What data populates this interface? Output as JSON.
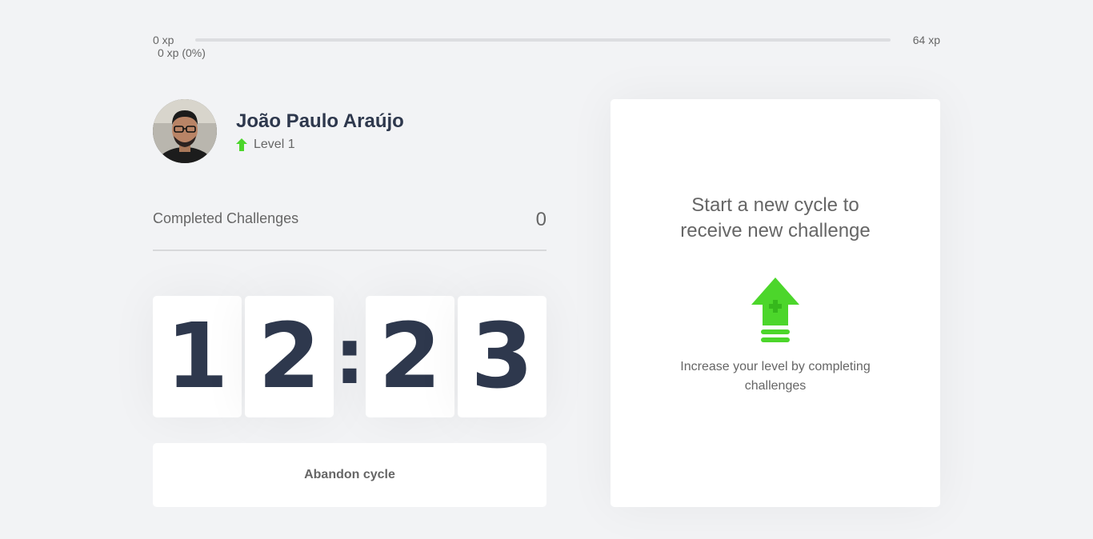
{
  "xp": {
    "min_label": "0 xp",
    "max_label": "64 xp",
    "current_label": "0 xp (0%)",
    "progress_percent": 0
  },
  "profile": {
    "name": "João Paulo Araújo",
    "level_label": "Level 1",
    "avatar_icon": "user-avatar-photo"
  },
  "completed": {
    "label": "Completed Challenges",
    "count": "0"
  },
  "countdown": {
    "minute_left": "1",
    "minute_right": "2",
    "separator": ":",
    "second_left": "2",
    "second_right": "3"
  },
  "abandon": {
    "label": "Abandon cycle"
  },
  "challenge": {
    "title": "Start a new cycle to receive new challenge",
    "hint": "Increase your level by completing challenges",
    "icon": "level-up-icon"
  },
  "colors": {
    "background": "#f2f3f5",
    "accent_green": "#4cd62b",
    "title_dark": "#2e384d",
    "text": "#666666"
  }
}
